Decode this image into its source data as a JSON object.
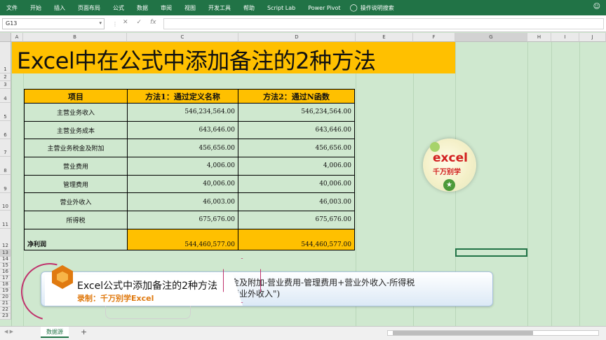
{
  "ribbon": {
    "tabs": [
      "文件",
      "开始",
      "插入",
      "页面布局",
      "公式",
      "数据",
      "审阅",
      "视图",
      "开发工具",
      "帮助",
      "Script Lab",
      "Power Pivot"
    ],
    "search_label": "操作说明搜索"
  },
  "formula_bar": {
    "name_box": "G13",
    "value": ""
  },
  "columns": [
    "A",
    "B",
    "C",
    "D",
    "E",
    "F",
    "G",
    "H",
    "I",
    "J"
  ],
  "rows": [
    "1",
    "2",
    "3",
    "4",
    "5",
    "6",
    "7",
    "8",
    "9",
    "10",
    "11",
    "12",
    "13",
    "14",
    "15",
    "16",
    "17",
    "18",
    "19",
    "20",
    "21",
    "22",
    "23"
  ],
  "sheet": {
    "title": "Excel中在公式中添加备注的2种方法",
    "table": {
      "headers": [
        "项目",
        "方法1：通过定义名称",
        "方法2：通过N函数"
      ],
      "rows": [
        [
          "主营业务收入",
          "546,234,564.00",
          "546,234,564.00"
        ],
        [
          "主营业务成本",
          "643,646.00",
          "643,646.00"
        ],
        [
          "主营业务税金及附加",
          "456,656.00",
          "456,656.00"
        ],
        [
          "营业费用",
          "4,006.00",
          "4,006.00"
        ],
        [
          "管理费用",
          "40,006.00",
          "40,006.00"
        ],
        [
          "营业外收入",
          "46,003.00",
          "46,003.00"
        ],
        [
          "所得税",
          "675,676.00",
          "675,676.00"
        ]
      ],
      "total": [
        "净利润",
        "544,460,577.00",
        "544,460,577.00"
      ]
    }
  },
  "overlay": {
    "caption_title": "Excel公式中添加备注的2种方法",
    "caption_sub": "录制：千万别学Excel",
    "formula_line1": "金及附加-营业费用-管理费用+营业外收入-所得税",
    "formula_line2": "营业外收入\")",
    "logo_line1": "excel",
    "logo_line2": "千万别学"
  },
  "bottom": {
    "sheet_tab": "数据源",
    "add_icon": "+"
  }
}
